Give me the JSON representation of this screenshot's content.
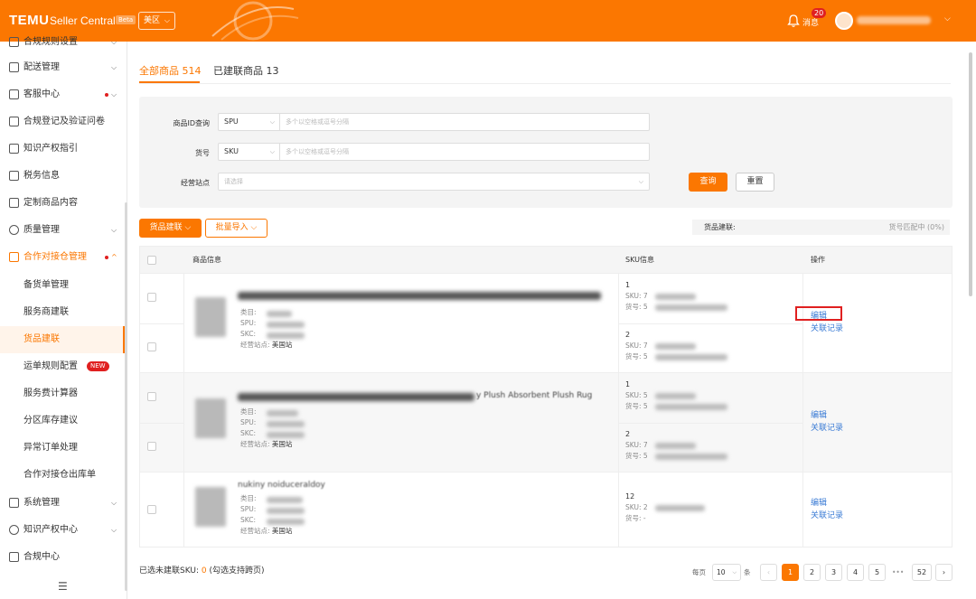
{
  "header": {
    "brand": "TEMU",
    "brand_sub": "Seller Central",
    "beta": "Beta",
    "region": "美区",
    "message_badge": "20",
    "message_label": "消息"
  },
  "sidebar": {
    "items": [
      {
        "label": "合规规则设置",
        "id": "top-cut"
      },
      {
        "label": "配送管理"
      },
      {
        "label": "客服中心"
      },
      {
        "label": "合规登记及验证问卷"
      },
      {
        "label": "知识产权指引"
      },
      {
        "label": "税务信息"
      },
      {
        "label": "定制商品内容"
      },
      {
        "label": "质量管理"
      },
      {
        "label": "合作对接仓管理"
      }
    ],
    "sub_items": [
      {
        "label": "备货单管理"
      },
      {
        "label": "服务商建联"
      },
      {
        "label": "货品建联"
      },
      {
        "label": "运单规则配置"
      },
      {
        "label": "服务费计算器"
      },
      {
        "label": "分区库存建议"
      },
      {
        "label": "异常订单处理"
      },
      {
        "label": "合作对接仓出库单"
      }
    ],
    "bottom_items": [
      {
        "label": "系统管理"
      },
      {
        "label": "知识产权中心"
      },
      {
        "label": "合规中心"
      }
    ],
    "new_badge": "NEW"
  },
  "tabs": [
    {
      "label": "全部商品 514"
    },
    {
      "label": "已建联商品 13"
    }
  ],
  "filters": {
    "id_label": "商品ID查询",
    "id_type": "SPU",
    "id_placeholder": "多个以空格或逗号分隔",
    "code_label": "货号",
    "code_type": "SKU",
    "code_placeholder": "多个以空格或逗号分隔",
    "site_label": "经营站点",
    "site_placeholder": "请选择",
    "search": "查询",
    "reset": "重置"
  },
  "toolbar": {
    "link_button": "货品建联",
    "import_button": "批量导入",
    "status_left": "货品建联:",
    "status_right": "货号匹配中 (0%)"
  },
  "table": {
    "col_product": "商品信息",
    "col_sku": "SKU信息",
    "col_action": "操作",
    "meta_labels": {
      "category": "类目:",
      "spu": "SPU:",
      "skc": "SKC:",
      "site": "经营站点:",
      "site_value": "美国站"
    },
    "sku_labels": {
      "sku": "SKU:",
      "code": "货号:"
    },
    "products": [
      {
        "title_tail": "",
        "sub_rows": [
          {
            "num": "1",
            "sku": "7",
            "code": "5"
          },
          {
            "num": "2",
            "sku": "7",
            "code": "5"
          }
        ]
      },
      {
        "title_tail": "y Plush Absorbent Plush Rug",
        "sub_rows": [
          {
            "num": "1",
            "sku": "5",
            "code": "5"
          },
          {
            "num": "2",
            "sku": "7",
            "code": "5"
          }
        ]
      },
      {
        "title_tail": "nukiny noiduceraldoy",
        "sub_rows": [
          {
            "num": "12",
            "sku": "2",
            "code": "-"
          }
        ]
      }
    ],
    "actions": {
      "edit": "编辑",
      "history": "关联记录"
    }
  },
  "footer": {
    "selected_prefix": "已选未建联SKU:",
    "selected_count": "0",
    "selected_suffix": "(勾选支持跨页)"
  },
  "pagination": {
    "per_page_label": "每页",
    "per_page": "10",
    "unit": "条",
    "pages": [
      "1",
      "2",
      "3",
      "4",
      "5"
    ],
    "ellipsis": "•••",
    "last": "52",
    "prev": "‹",
    "next": "›"
  }
}
